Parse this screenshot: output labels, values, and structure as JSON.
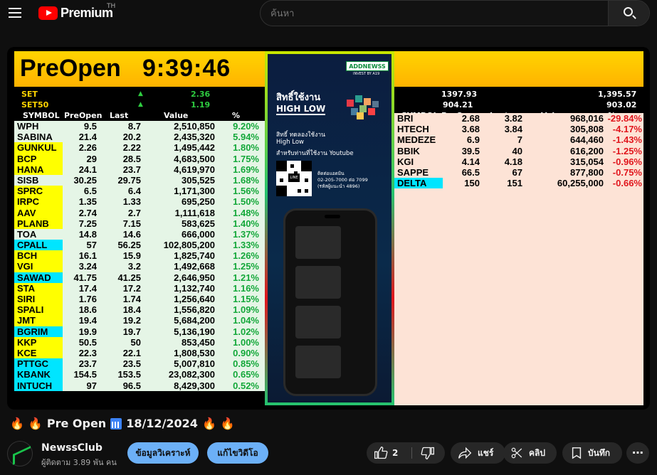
{
  "topbar": {
    "brand": "Premium",
    "brand_sup": "TH",
    "search_placeholder": "ค้นหา"
  },
  "video": {
    "header_title": "PreOpen",
    "header_time": "9:39:46",
    "indices": [
      {
        "name": "SET",
        "change": "2.36"
      },
      {
        "name": "SET50",
        "change": "1.19"
      }
    ],
    "right_index_values": [
      {
        "left": "1397.93",
        "right": "1,395.57"
      },
      {
        "left": "904.21",
        "right": "903.02"
      }
    ],
    "columns": [
      "SYMBOL",
      "PreOpen",
      "Last",
      "Value",
      "%"
    ],
    "left_rows": [
      {
        "symbol": "WPH",
        "preopen": "9.5",
        "last": "8.7",
        "value": "2,510,850",
        "pct": "9.20%",
        "hl": "none"
      },
      {
        "symbol": "SABINA",
        "preopen": "21.4",
        "last": "20.2",
        "value": "2,435,320",
        "pct": "5.94%",
        "hl": "none"
      },
      {
        "symbol": "GUNKUL",
        "preopen": "2.26",
        "last": "2.22",
        "value": "1,495,442",
        "pct": "1.80%",
        "hl": "yellow"
      },
      {
        "symbol": "BCP",
        "preopen": "29",
        "last": "28.5",
        "value": "4,683,500",
        "pct": "1.75%",
        "hl": "yellow"
      },
      {
        "symbol": "HANA",
        "preopen": "24.1",
        "last": "23.7",
        "value": "4,619,970",
        "pct": "1.69%",
        "hl": "yellow"
      },
      {
        "symbol": "SISB",
        "preopen": "30.25",
        "last": "29.75",
        "value": "305,525",
        "pct": "1.68%",
        "hl": "none"
      },
      {
        "symbol": "SPRC",
        "preopen": "6.5",
        "last": "6.4",
        "value": "1,171,300",
        "pct": "1.56%",
        "hl": "yellow"
      },
      {
        "symbol": "IRPC",
        "preopen": "1.35",
        "last": "1.33",
        "value": "695,250",
        "pct": "1.50%",
        "hl": "yellow"
      },
      {
        "symbol": "AAV",
        "preopen": "2.74",
        "last": "2.7",
        "value": "1,111,618",
        "pct": "1.48%",
        "hl": "yellow"
      },
      {
        "symbol": "PLANB",
        "preopen": "7.25",
        "last": "7.15",
        "value": "583,625",
        "pct": "1.40%",
        "hl": "yellow"
      },
      {
        "symbol": "TOA",
        "preopen": "14.8",
        "last": "14.6",
        "value": "666,000",
        "pct": "1.37%",
        "hl": "none"
      },
      {
        "symbol": "CPALL",
        "preopen": "57",
        "last": "56.25",
        "value": "102,805,200",
        "pct": "1.33%",
        "hl": "cyan"
      },
      {
        "symbol": "BCH",
        "preopen": "16.1",
        "last": "15.9",
        "value": "1,825,740",
        "pct": "1.26%",
        "hl": "yellow"
      },
      {
        "symbol": "VGI",
        "preopen": "3.24",
        "last": "3.2",
        "value": "1,492,668",
        "pct": "1.25%",
        "hl": "yellow"
      },
      {
        "symbol": "SAWAD",
        "preopen": "41.75",
        "last": "41.25",
        "value": "2,646,950",
        "pct": "1.21%",
        "hl": "cyan"
      },
      {
        "symbol": "STA",
        "preopen": "17.4",
        "last": "17.2",
        "value": "1,132,740",
        "pct": "1.16%",
        "hl": "yellow"
      },
      {
        "symbol": "SIRI",
        "preopen": "1.76",
        "last": "1.74",
        "value": "1,256,640",
        "pct": "1.15%",
        "hl": "yellow"
      },
      {
        "symbol": "SPALI",
        "preopen": "18.6",
        "last": "18.4",
        "value": "1,556,820",
        "pct": "1.09%",
        "hl": "yellow"
      },
      {
        "symbol": "JMT",
        "preopen": "19.4",
        "last": "19.2",
        "value": "5,684,200",
        "pct": "1.04%",
        "hl": "yellow"
      },
      {
        "symbol": "BGRIM",
        "preopen": "19.9",
        "last": "19.7",
        "value": "5,136,190",
        "pct": "1.02%",
        "hl": "cyan"
      },
      {
        "symbol": "KKP",
        "preopen": "50.5",
        "last": "50",
        "value": "853,450",
        "pct": "1.00%",
        "hl": "yellow"
      },
      {
        "symbol": "KCE",
        "preopen": "22.3",
        "last": "22.1",
        "value": "1,808,530",
        "pct": "0.90%",
        "hl": "yellow"
      },
      {
        "symbol": "PTTGC",
        "preopen": "23.7",
        "last": "23.5",
        "value": "5,007,810",
        "pct": "0.85%",
        "hl": "cyan"
      },
      {
        "symbol": "KBANK",
        "preopen": "154.5",
        "last": "153.5",
        "value": "23,082,300",
        "pct": "0.65%",
        "hl": "cyan"
      },
      {
        "symbol": "INTUCH",
        "preopen": "97",
        "last": "96.5",
        "value": "8,429,300",
        "pct": "0.52%",
        "hl": "cyan"
      }
    ],
    "right_rows": [
      {
        "symbol": "BRI",
        "preopen": "2.68",
        "last": "3.82",
        "value": "968,016",
        "pct": "-29.84%",
        "hl": "none"
      },
      {
        "symbol": "HTECH",
        "preopen": "3.68",
        "last": "3.84",
        "value": "305,808",
        "pct": "-4.17%",
        "hl": "none"
      },
      {
        "symbol": "MEDEZE",
        "preopen": "6.9",
        "last": "7",
        "value": "644,460",
        "pct": "-1.43%",
        "hl": "none"
      },
      {
        "symbol": "BBIK",
        "preopen": "39.5",
        "last": "40",
        "value": "616,200",
        "pct": "-1.25%",
        "hl": "none"
      },
      {
        "symbol": "KGI",
        "preopen": "4.14",
        "last": "4.18",
        "value": "315,054",
        "pct": "-0.96%",
        "hl": "none"
      },
      {
        "symbol": "SAPPE",
        "preopen": "66.5",
        "last": "67",
        "value": "877,800",
        "pct": "-0.75%",
        "hl": "none"
      },
      {
        "symbol": "DELTA",
        "preopen": "150",
        "last": "151",
        "value": "60,255,000",
        "pct": "-0.66%",
        "hl": "cyan"
      }
    ],
    "ad": {
      "tag": "ADDNEWSS",
      "tag_sub": "INVEST BY A19",
      "headline1": "สิทธิ์ใช้งาน",
      "headline2": "HIGH LOW",
      "line1": "สิทธิ์ ทดลองใช้งาน",
      "line2": "High Low",
      "line3": "สำหรับท่านที่ใช้งาน Youtube",
      "qr_label": "LINE",
      "contact1": "ติดต่อแอดมิน",
      "contact2": "02-205-7000 ต่อ 7099",
      "contact3": "(รหัสผู้แนะนำ 4896)"
    }
  },
  "video_title": {
    "text": "Pre Open",
    "date": "18/12/2024"
  },
  "channel": {
    "name": "NewssClub",
    "subs": "ผู้ติดตาม 3.89 พัน คน",
    "btn_analysis": "ข้อมูลวิเคราะห์",
    "btn_edit": "แก้ไขวิดีโอ",
    "likes": "2",
    "share": "แชร์",
    "clip": "คลิป",
    "save": "บันทึก"
  },
  "colors": {
    "yellow_hl": "#ffff00",
    "cyan_hl": "#00e5ff",
    "green_pct": "#14a83a",
    "red_pct": "#e1161d",
    "left_row_bg": "#e5f5e6",
    "right_row_bg": "#fde3d6"
  }
}
